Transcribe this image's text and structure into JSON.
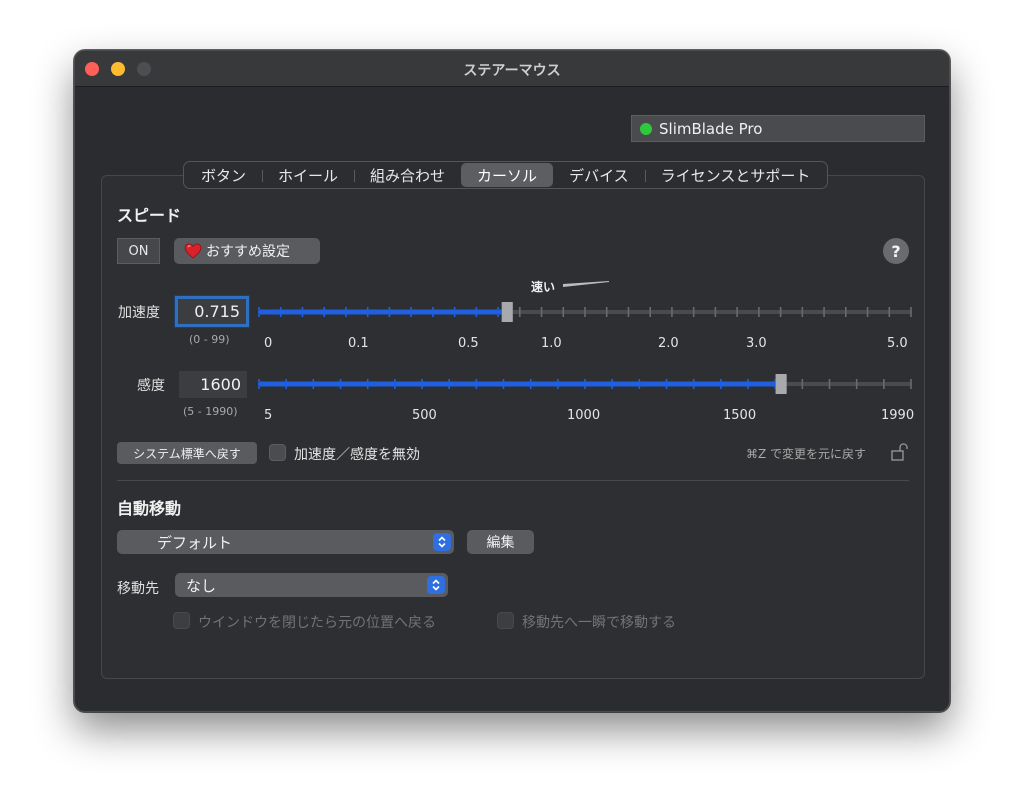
{
  "window": {
    "title": "ステアーマウス"
  },
  "device": {
    "name": "SlimBlade Pro",
    "status_color": "#2dcb3c"
  },
  "tabs": [
    {
      "label": "ボタン",
      "active": false
    },
    {
      "label": "ホイール",
      "active": false
    },
    {
      "label": "組み合わせ",
      "active": false
    },
    {
      "label": "カーソル",
      "active": true
    },
    {
      "label": "デバイス",
      "active": false
    },
    {
      "label": "ライセンスとサポート",
      "active": false
    }
  ],
  "speed": {
    "title": "スピード",
    "on_label": "ON",
    "recommended_label": "おすすめ設定",
    "help_label": "?",
    "fast_label": "速い",
    "acceleration": {
      "label": "加速度",
      "value": "0.715",
      "range": "(0 - 99)",
      "tick_labels": [
        "0",
        "0.1",
        "0.5",
        "1.0",
        "2.0",
        "3.0",
        "5.0"
      ],
      "fill_fraction": 0.38
    },
    "sensitivity": {
      "label": "感度",
      "value": "1600",
      "range": "(5 - 1990)",
      "tick_labels": [
        "5",
        "500",
        "1000",
        "1500",
        "1990"
      ],
      "fill_fraction": 0.8
    },
    "reset_label": "システム標準へ戻す",
    "disable_label": "加速度／感度を無効",
    "undo_label": "⌘Z で変更を元に戻す"
  },
  "auto_move": {
    "title": "自動移動",
    "preset_value": "デフォルト",
    "edit_label": "編集",
    "destination_label": "移動先",
    "destination_value": "なし",
    "return_label": "ウインドウを閉じたら元の位置へ戻る",
    "instant_label": "移動先へ一瞬で移動する"
  },
  "colors": {
    "accent": "#2f6fe0",
    "slider_fill": "#1f5fe0"
  }
}
